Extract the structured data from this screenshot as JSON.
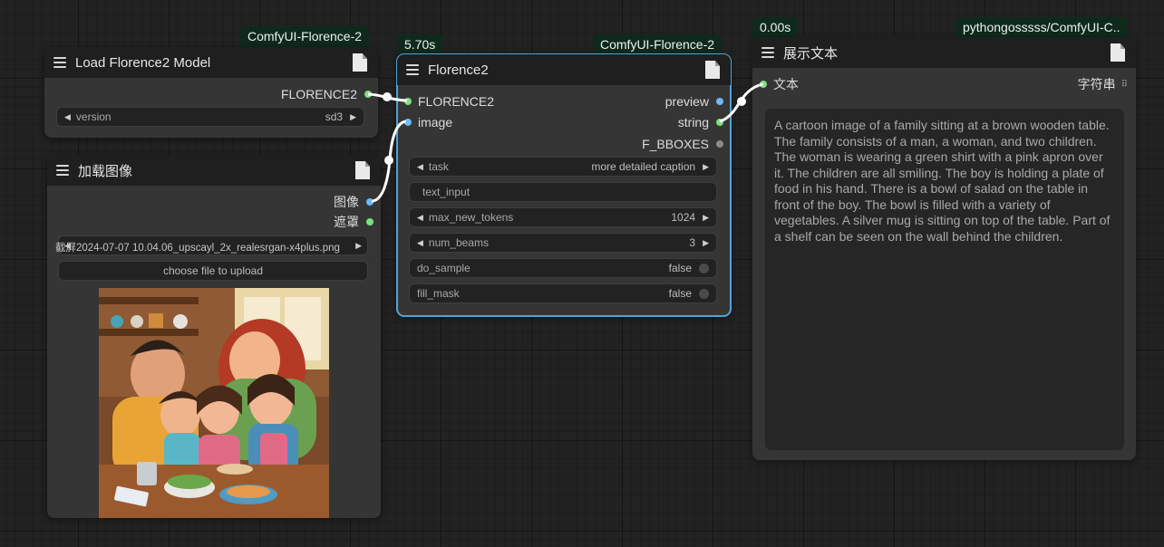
{
  "badges": {
    "load_model_pkg": "ComfyUI-Florence-2",
    "florence_time": "5.70s",
    "florence_pkg": "ComfyUI-Florence-2",
    "show_time": "0.00s",
    "show_pkg": "pythongosssss/ComfyUI-C.."
  },
  "load_model": {
    "title": "Load Florence2 Model",
    "output": "FLORENCE2",
    "version_label": "version",
    "version_value": "sd3"
  },
  "load_image": {
    "title": "加载图像",
    "output_image": "图像",
    "output_mask": "遮罩",
    "filename": "截屏2024-07-07 10.04.06_upscayl_2x_realesrgan-x4plus.png",
    "upload_button": "choose file to upload"
  },
  "florence": {
    "title": "Florence2",
    "input_model": "FLORENCE2",
    "input_image": "image",
    "output_preview": "preview",
    "output_string": "string",
    "output_bboxes": "F_BBOXES",
    "task_label": "task",
    "task_value": "more detailed caption",
    "text_input_placeholder": "text_input",
    "max_tokens_label": "max_new_tokens",
    "max_tokens_value": "1024",
    "num_beams_label": "num_beams",
    "num_beams_value": "3",
    "do_sample_label": "do_sample",
    "do_sample_value": "false",
    "fill_mask_label": "fill_mask",
    "fill_mask_value": "false"
  },
  "show_text": {
    "title": "展示文本",
    "input": "文本",
    "type": "字符串",
    "content": "A cartoon image of a family sitting at a brown wooden table. The family consists of a man, a woman, and two children. The woman is wearing a green shirt with a pink apron over it. The children are all smiling. The boy is holding a plate of food in his hand. There is a bowl of salad on the table in front of the boy. The bowl is filled with a variety of vegetables. A silver mug is sitting on top of the table. Part of a shelf can be seen on the wall behind the children."
  },
  "colors": {
    "canvas": "#222222",
    "node_body": "#353535",
    "node_header": "#1f1f1f",
    "badge": "#0f2a1d",
    "slot_green": "#7ee07e",
    "slot_blue": "#6fb8f5",
    "selected_outline": "#4fa3d6"
  }
}
